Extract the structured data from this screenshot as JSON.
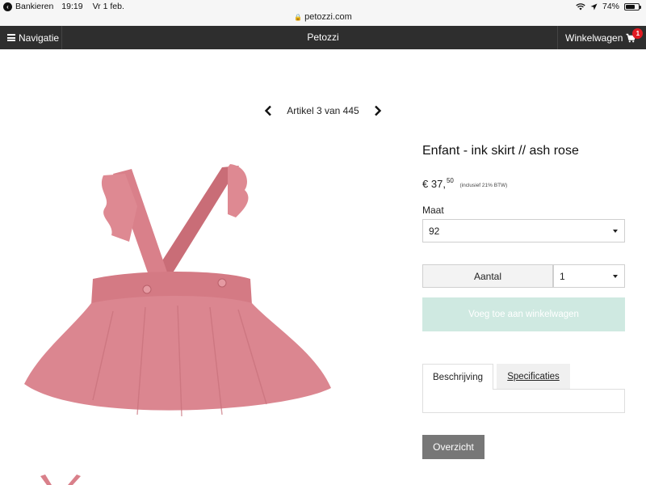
{
  "statusbar": {
    "back_app": "Bankieren",
    "time": "19:19",
    "date": "Vr 1 feb.",
    "url": "petozzi.com",
    "battery": "74%",
    "battery_level": 0.74
  },
  "nav": {
    "menu_label": "Navigatie",
    "site_title": "Petozzi",
    "cart_label": "Winkelwagen",
    "cart_count": "1"
  },
  "pager": {
    "text": "Artikel 3 van 445"
  },
  "product": {
    "title": "Enfant - ink skirt // ash rose",
    "price_currency": "€",
    "price_whole": "37,",
    "price_cents": "50",
    "price_note": "(inclusief 21% BTW)",
    "size_label": "Maat",
    "size_value": "92",
    "quantity_label": "Aantal",
    "quantity_value": "1",
    "add_to_cart": "Voeg toe aan winkelwagen",
    "tabs": [
      {
        "label": "Beschrijving"
      },
      {
        "label": "Specificaties"
      }
    ],
    "overview_button": "Overzicht"
  },
  "colors": {
    "navbar": "#2e2e2e",
    "badge": "#e01b22",
    "add_to_cart_bg": "#cfe9e1",
    "skirt": "#d97f88",
    "overview_bg": "#777777"
  }
}
